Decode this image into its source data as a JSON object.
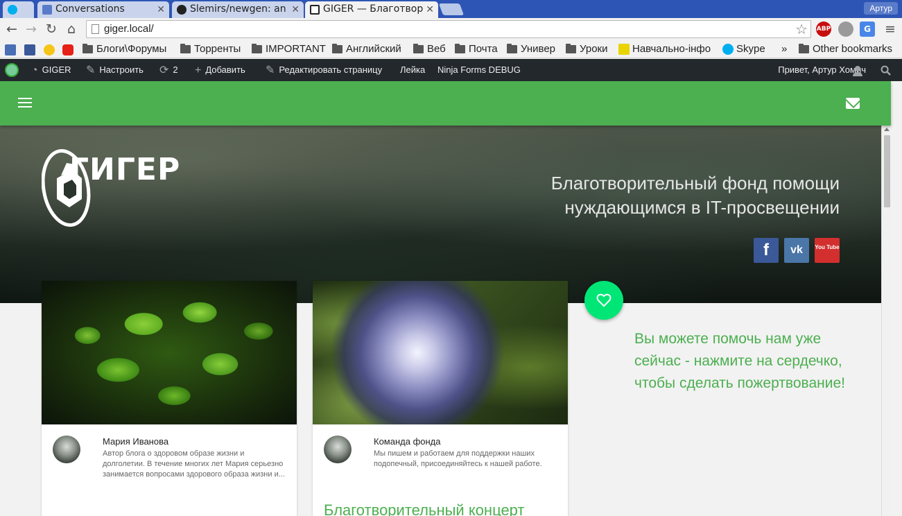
{
  "browser": {
    "tabs": [
      {
        "label": "",
        "favicon": "skype-icon"
      },
      {
        "label": "Conversations",
        "favicon": "chat-icon"
      },
      {
        "label": "Slemirs/newgen: an",
        "favicon": "github-icon"
      },
      {
        "label": "GIGER — Благотвор",
        "favicon": "giger-icon"
      }
    ],
    "profile_label": "Артур",
    "url": "giger.local/",
    "extensions": [
      {
        "name": "abp-icon",
        "label": "ABP",
        "color": "#c70d0d"
      },
      {
        "name": "extension-icon",
        "label": "",
        "color": "#888888"
      },
      {
        "name": "translate-icon",
        "label": "G",
        "color": "#4a86e8"
      }
    ]
  },
  "bookmarks": {
    "items": [
      {
        "label": "Блоги\\Форумы"
      },
      {
        "label": "Торренты"
      },
      {
        "label": "IMPORTANT"
      },
      {
        "label": "Английский"
      },
      {
        "label": "Веб"
      },
      {
        "label": "Почта"
      },
      {
        "label": "Универ"
      },
      {
        "label": "Уроки"
      }
    ],
    "navchalno": "Навчально-інфо",
    "skype": "Skype",
    "overflow": "»",
    "other": "Other bookmarks"
  },
  "adminbar": {
    "site_name": "GIGER",
    "customize": "Настроить",
    "updates_count": "2",
    "add_new": "Добавить",
    "edit_page": "Редактировать страницу",
    "leyka": "Лейка",
    "ninja_forms": "Ninja Forms DEBUG",
    "greeting": "Привет, Артур Хомич"
  },
  "hero": {
    "logo_word": "ГИГЕР",
    "tagline_line1": "Благотворительный фонд помощи",
    "tagline_line2": "нуждающимся в IT-просвещении",
    "social": [
      {
        "name": "facebook-icon",
        "label": "f",
        "color": "#3b5998"
      },
      {
        "name": "vk-icon",
        "label": "vk",
        "color": "#4a76a8"
      },
      {
        "name": "youtube-icon",
        "label": "You Tube",
        "color": "#d32f2f"
      }
    ]
  },
  "cards": [
    {
      "author": "Мария Иванова",
      "bio": "Автор блога о здоровом образе жизни и долголетии. В течение многих лет Мария серьезно занимается вопросами здорового образа жизни и...",
      "title": ""
    },
    {
      "author": "Команда фонда",
      "bio": "Мы пишем и работаем для поддержки наших подопечный, присоединяйтесь к нашей работе.",
      "title": "Благотворительный концерт"
    }
  ],
  "donate": {
    "text": "Вы можете помочь нам уже сейчас - нажмите на сердечко, чтобы сделать пожертвование!"
  },
  "colors": {
    "brand_green": "#4caf50",
    "accent_green": "#00e676",
    "adminbar": "#23282d",
    "chrome_blue": "#2d55b5"
  }
}
